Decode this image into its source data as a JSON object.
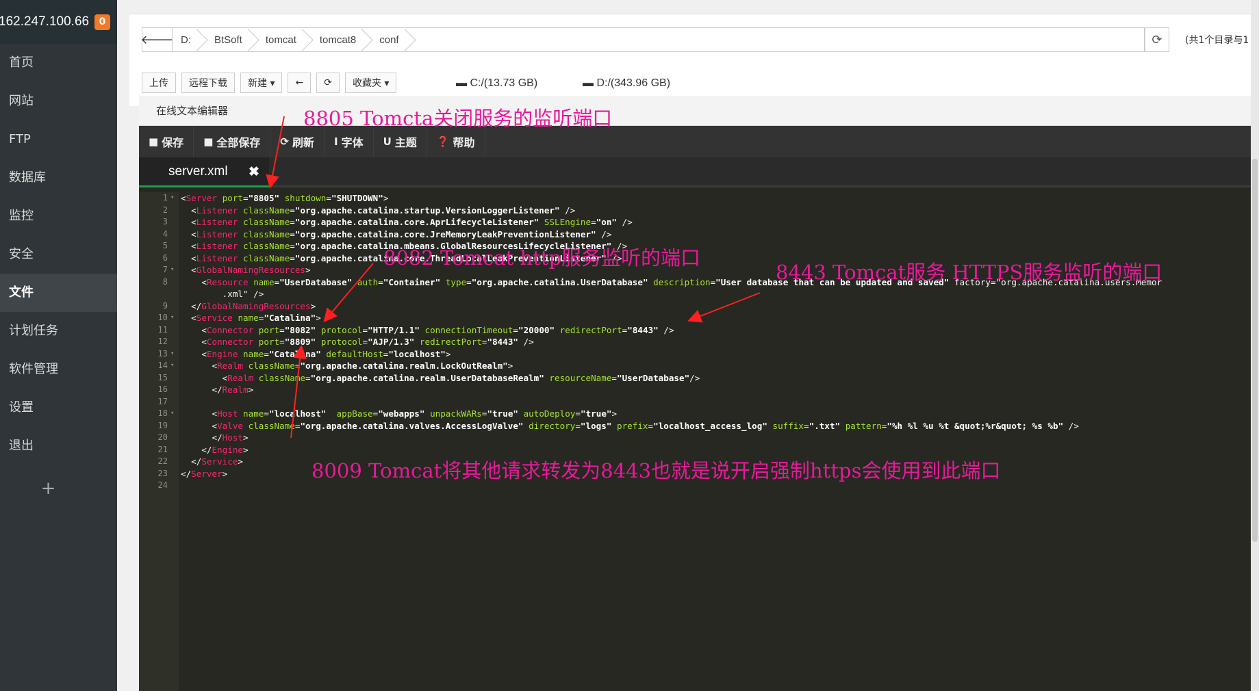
{
  "sidebar": {
    "ip": "162.247.100.66",
    "badge": "0",
    "items": [
      "首页",
      "网站",
      "FTP",
      "数据库",
      "监控",
      "安全",
      "文件",
      "计划任务",
      "软件管理",
      "设置",
      "退出"
    ],
    "active": "文件",
    "add": "+"
  },
  "pathbar": {
    "crumbs": [
      "D:",
      "BtSoft",
      "tomcat",
      "tomcat8",
      "conf"
    ],
    "summary": "(共1个目录与1"
  },
  "toolbar": {
    "buttons": [
      "上传",
      "远程下载",
      "新建 ▾",
      "←",
      "⟳",
      "收藏夹 ▾"
    ],
    "disk_c": "C:/(13.73 GB)",
    "disk_d": "D:/(343.96 GB)"
  },
  "editor": {
    "title": "在线文本编辑器",
    "buttons": [
      {
        "icon": "save-icon",
        "label": "保存"
      },
      {
        "icon": "save-all-icon",
        "label": "全部保存"
      },
      {
        "icon": "refresh-icon",
        "label": "刷新"
      },
      {
        "icon": "font-icon",
        "label": "字体"
      },
      {
        "icon": "theme-icon",
        "label": "主题"
      },
      {
        "icon": "help-icon",
        "label": "帮助"
      }
    ],
    "tab": "server.xml",
    "lines": [
      "<Server port=\"8805\" shutdown=\"SHUTDOWN\">",
      "  <Listener className=\"org.apache.catalina.startup.VersionLoggerListener\" />",
      "  <Listener className=\"org.apache.catalina.core.AprLifecycleListener\" SSLEngine=\"on\" />",
      "  <Listener className=\"org.apache.catalina.core.JreMemoryLeakPreventionListener\" />",
      "  <Listener className=\"org.apache.catalina.mbeans.GlobalResourcesLifecycleListener\" />",
      "  <Listener className=\"org.apache.catalina.core.ThreadLocalLeakPreventionListener\" />",
      "  <GlobalNamingResources>",
      "    <Resource name=\"UserDatabase\" auth=\"Container\" type=\"org.apache.catalina.UserDatabase\" description=\"User database that can be updated and saved\" factory=\"org.apache.catalina.users.Memor",
      "        .xml\" />",
      "  </GlobalNamingResources>",
      "  <Service name=\"Catalina\">",
      "    <Connector port=\"8082\" protocol=\"HTTP/1.1\" connectionTimeout=\"20000\" redirectPort=\"8443\" />",
      "    <Connector port=\"8809\" protocol=\"AJP/1.3\" redirectPort=\"8443\" />",
      "    <Engine name=\"Catalina\" defaultHost=\"localhost\">",
      "      <Realm className=\"org.apache.catalina.realm.LockOutRealm\">",
      "        <Realm className=\"org.apache.catalina.realm.UserDatabaseRealm\" resourceName=\"UserDatabase\"/>",
      "      </Realm>",
      "",
      "      <Host name=\"localhost\"  appBase=\"webapps\" unpackWARs=\"true\" autoDeploy=\"true\">",
      "      <Valve className=\"org.apache.catalina.valves.AccessLogValve\" directory=\"logs\" prefix=\"localhost_access_log\" suffix=\".txt\" pattern=\"%h %l %u %t &quot;%r&quot; %s %b\" />",
      "      </Host>",
      "    </Engine>",
      "  </Service>",
      "</Server>",
      ""
    ],
    "line_numbers": [
      "1",
      "2",
      "3",
      "4",
      "5",
      "6",
      "7",
      "8",
      "",
      "9",
      "10",
      "11",
      "12",
      "13",
      "14",
      "15",
      "16",
      "17",
      "18",
      "19",
      "20",
      "21",
      "22",
      "23",
      "24"
    ]
  },
  "annotations": [
    {
      "text": "8805    Tomcta关闭服务的监听端口",
      "color": "#e8199a"
    },
    {
      "text": "8082    Tomcat http服务监听的端口",
      "color": "#e8199a"
    },
    {
      "text": "8443 Tomcat服务 HTTPS服务监听的端口",
      "color": "#e8199a"
    },
    {
      "text": "8009 Tomcat将其他请求转发为8443也就是说开启强制https会使用到此端口",
      "color": "#e8199a"
    }
  ]
}
